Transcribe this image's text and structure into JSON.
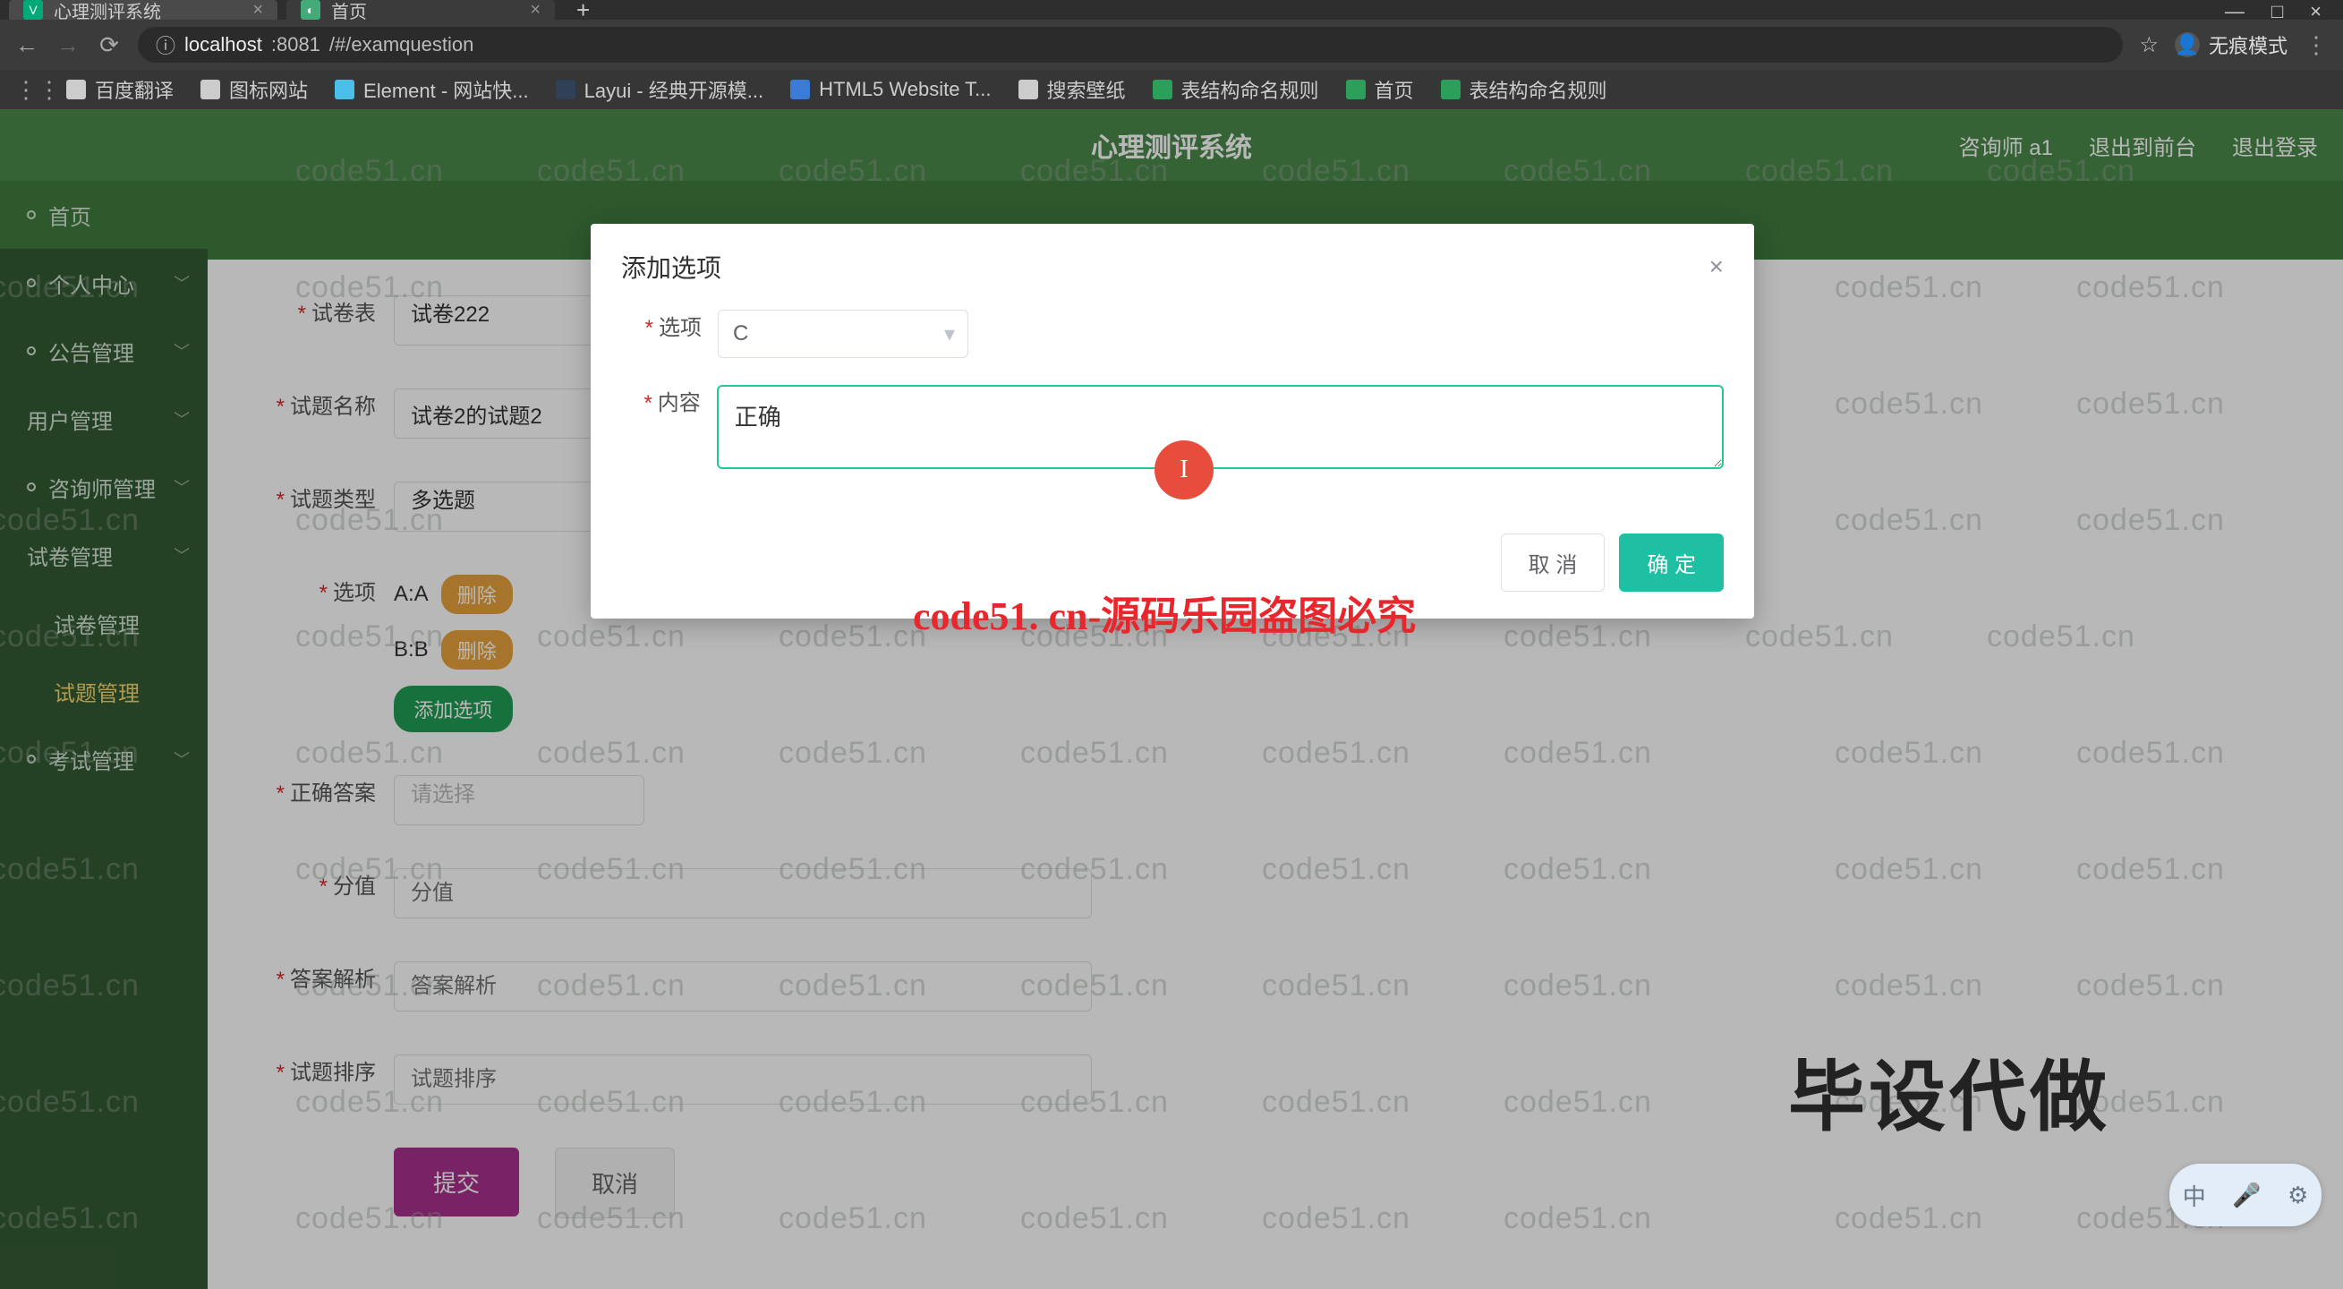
{
  "browser": {
    "tabs": [
      {
        "title": "心理测评系统",
        "active": true,
        "glyph": "V"
      },
      {
        "title": "首页",
        "active": false,
        "glyph": "◐"
      }
    ],
    "win": {
      "min": "—",
      "max": "□",
      "close": "×"
    },
    "addr": {
      "info_icon": "ⓘ",
      "host": "localhost",
      "port": ":8081",
      "path": "/#/examquestion"
    },
    "incognito": "无痕模式",
    "menu": "⋮",
    "bookmarks": [
      {
        "label": "百度翻译"
      },
      {
        "label": "图标网站"
      },
      {
        "label": "Element - 网站快..."
      },
      {
        "label": "Layui - 经典开源模..."
      },
      {
        "label": "HTML5 Website T..."
      },
      {
        "label": "搜索壁纸"
      },
      {
        "label": "表结构命名规则"
      },
      {
        "label": "首页"
      },
      {
        "label": "表结构命名规则"
      }
    ]
  },
  "app": {
    "title": "心理测评系统",
    "right": {
      "user": "咨询师 a1",
      "back": "退出到前台",
      "logout": "退出登录"
    }
  },
  "sidebar": {
    "items": [
      {
        "label": "首页",
        "top": true
      },
      {
        "label": "个人中心",
        "caret": true
      },
      {
        "label": "公告管理",
        "caret": true
      },
      {
        "label": "用户管理",
        "caret": true
      },
      {
        "label": "咨询师管理",
        "caret": true
      },
      {
        "label": "试卷管理",
        "caret": true
      },
      {
        "label": "试卷管理"
      },
      {
        "label": "试题管理",
        "active": true
      },
      {
        "label": "考试管理",
        "caret": true
      }
    ]
  },
  "form": {
    "paper": {
      "label": "试卷表",
      "value": "试卷222"
    },
    "qname": {
      "label": "试题名称",
      "value": "试卷2的试题2"
    },
    "qtype": {
      "label": "试题类型",
      "value": "多选题"
    },
    "options": {
      "label": "选项",
      "rows": [
        {
          "code": "A:A"
        },
        {
          "code": "B:B"
        }
      ],
      "del": "删除",
      "add": "添加选项"
    },
    "answer": {
      "label": "正确答案",
      "placeholder": "请选择"
    },
    "score": {
      "label": "分值",
      "placeholder": "分值"
    },
    "analysis": {
      "label": "答案解析",
      "placeholder": "答案解析"
    },
    "order": {
      "label": "试题排序",
      "placeholder": "试题排序"
    },
    "submit": "提交",
    "cancel": "取消"
  },
  "modal": {
    "title": "添加选项",
    "close": "×",
    "optLabel": "选项",
    "optValue": "C",
    "contentLabel": "内容",
    "contentValue": "正确",
    "cancel": "取 消",
    "ok": "确 定"
  },
  "overlay": {
    "wm": "code51.cn",
    "red_banner": "code51. cn-源码乐园盗图必究",
    "big_gray": "毕设代做",
    "red_dot": "I",
    "ime": "中"
  }
}
